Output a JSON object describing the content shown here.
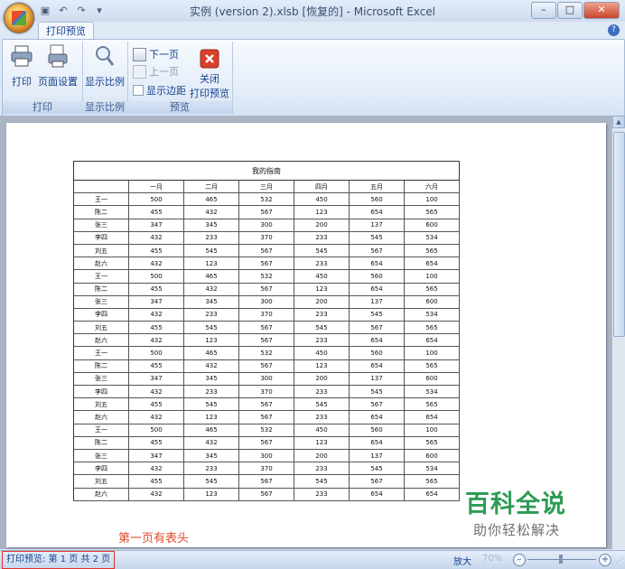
{
  "window": {
    "title": "实例 (version 2).xlsb [恢复的] - Microsoft Excel",
    "minimize": "–",
    "maximize": "□",
    "close": "✕"
  },
  "tabs": [
    {
      "label": "打印预览",
      "active": true
    }
  ],
  "ribbon": {
    "groups": {
      "print": {
        "label": "打印",
        "print_btn": "打印",
        "page_setup_btn": "页面设置"
      },
      "zoom": {
        "label": "显示比例",
        "zoom_btn": "显示比例"
      },
      "preview": {
        "label": "预览",
        "next_page": "下一页",
        "prev_page": "上一页",
        "show_margins": "显示边距",
        "close_label_1": "关闭",
        "close_label_2": "打印预览"
      }
    }
  },
  "sheet": {
    "title": "我的指南",
    "headers": [
      "",
      "一月",
      "二月",
      "三月",
      "四月",
      "五月",
      "六月"
    ],
    "rows": [
      [
        "王一",
        "500",
        "465",
        "532",
        "450",
        "560",
        "100"
      ],
      [
        "陈二",
        "455",
        "432",
        "567",
        "123",
        "654",
        "565"
      ],
      [
        "张三",
        "347",
        "345",
        "300",
        "200",
        "137",
        "600"
      ],
      [
        "李四",
        "432",
        "233",
        "370",
        "233",
        "545",
        "534"
      ],
      [
        "刘五",
        "455",
        "545",
        "567",
        "545",
        "567",
        "565"
      ],
      [
        "赵六",
        "432",
        "123",
        "567",
        "233",
        "654",
        "654"
      ],
      [
        "王一",
        "500",
        "465",
        "532",
        "450",
        "560",
        "100"
      ],
      [
        "陈二",
        "455",
        "432",
        "567",
        "123",
        "654",
        "565"
      ],
      [
        "张三",
        "347",
        "345",
        "300",
        "200",
        "137",
        "600"
      ],
      [
        "李四",
        "432",
        "233",
        "370",
        "233",
        "545",
        "534"
      ],
      [
        "刘五",
        "455",
        "545",
        "567",
        "545",
        "567",
        "565"
      ],
      [
        "赵六",
        "432",
        "123",
        "567",
        "233",
        "654",
        "654"
      ],
      [
        "王一",
        "500",
        "465",
        "532",
        "450",
        "560",
        "100"
      ],
      [
        "陈二",
        "455",
        "432",
        "567",
        "123",
        "654",
        "565"
      ],
      [
        "张三",
        "347",
        "345",
        "300",
        "200",
        "137",
        "600"
      ],
      [
        "李四",
        "432",
        "233",
        "370",
        "233",
        "545",
        "534"
      ],
      [
        "刘五",
        "455",
        "545",
        "567",
        "545",
        "567",
        "565"
      ],
      [
        "赵六",
        "432",
        "123",
        "567",
        "233",
        "654",
        "654"
      ],
      [
        "王一",
        "500",
        "465",
        "532",
        "450",
        "560",
        "100"
      ],
      [
        "陈二",
        "455",
        "432",
        "567",
        "123",
        "654",
        "565"
      ],
      [
        "张三",
        "347",
        "345",
        "300",
        "200",
        "137",
        "600"
      ],
      [
        "李四",
        "432",
        "233",
        "370",
        "233",
        "545",
        "534"
      ],
      [
        "刘五",
        "455",
        "545",
        "567",
        "545",
        "567",
        "565"
      ],
      [
        "赵六",
        "432",
        "123",
        "567",
        "233",
        "654",
        "654"
      ]
    ]
  },
  "annotation": "第一页有表头",
  "watermark": {
    "line1": "百科全说",
    "line2": "助你轻松解决"
  },
  "status": {
    "left": "打印预览: 第 1 页  共 2 页",
    "zoom_label": "放大",
    "zoom_value": "70%"
  },
  "colors": {
    "annotation": "#e04a2a",
    "watermark": "#2e9b55",
    "status_highlight": "#e0302a"
  }
}
